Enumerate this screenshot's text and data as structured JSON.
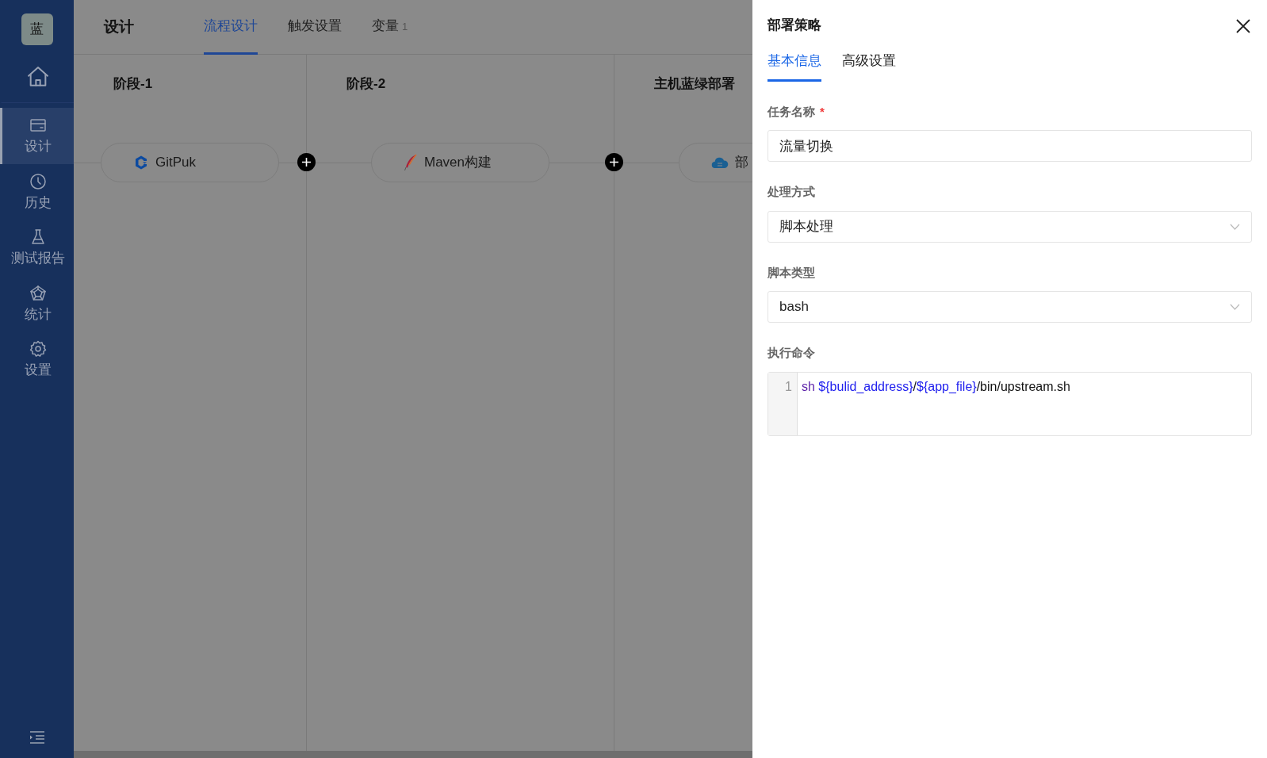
{
  "sidebar": {
    "logo": "蓝",
    "items": [
      {
        "kind": "home",
        "selected": false
      },
      {
        "kind": "design",
        "label": "设计",
        "selected": true
      },
      {
        "kind": "history",
        "label": "历史",
        "selected": false
      },
      {
        "kind": "test",
        "label": "测试报告",
        "selected": false
      },
      {
        "kind": "stats",
        "label": "统计",
        "selected": false
      },
      {
        "kind": "settings",
        "label": "设置",
        "selected": false
      }
    ]
  },
  "header": {
    "title": "设计",
    "tabs": [
      {
        "label": "流程设计",
        "selected": true
      },
      {
        "label": "触发设置",
        "selected": false
      },
      {
        "label": "变量",
        "count": "1",
        "selected": false
      }
    ]
  },
  "stages": [
    {
      "title": "阶段-1",
      "task": {
        "kind": "git",
        "label": "GitPuk"
      }
    },
    {
      "title": "阶段-2",
      "task": {
        "kind": "maven",
        "label": "Maven构建"
      }
    },
    {
      "title": "主机蓝绿部署",
      "task": {
        "kind": "cloud",
        "label": "部"
      }
    }
  ],
  "drawer": {
    "title": "部署策略",
    "tabs": [
      {
        "label": "基本信息",
        "selected": true
      },
      {
        "label": "高级设置",
        "selected": false
      }
    ],
    "fields": [
      {
        "kind": "input",
        "label": "任务名称",
        "required_mark": "*",
        "value": "流量切换"
      },
      {
        "kind": "select",
        "label": "处理方式",
        "value": "脚本处理"
      },
      {
        "kind": "select",
        "label": "脚本类型",
        "value": "bash"
      },
      {
        "kind": "code",
        "label": "执行命令",
        "line_number": "1",
        "tokens": [
          {
            "kind": "keyword",
            "text": "sh "
          },
          {
            "kind": "variable",
            "text": "${bulid_address}"
          },
          {
            "kind": "plain",
            "text": "/"
          },
          {
            "kind": "variable",
            "text": "${app_file}"
          },
          {
            "kind": "plain",
            "text": "/bin/upstream.sh"
          }
        ]
      }
    ]
  }
}
